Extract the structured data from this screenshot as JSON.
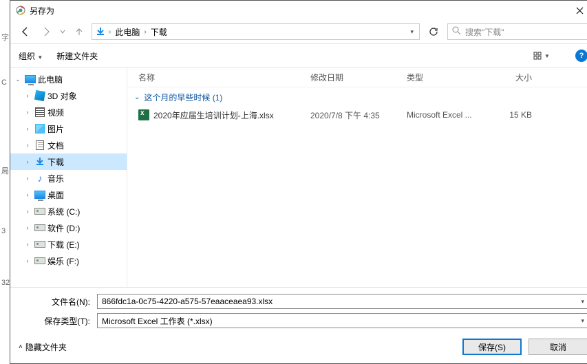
{
  "title": "另存为",
  "nav": {
    "path_segments": [
      "此电脑",
      "下载"
    ],
    "search_placeholder": "搜索\"下载\""
  },
  "toolbar": {
    "organize": "组织",
    "new_folder": "新建文件夹"
  },
  "tree": {
    "root": "此电脑",
    "items": [
      {
        "label": "3D 对象",
        "icon": "cube"
      },
      {
        "label": "视频",
        "icon": "film"
      },
      {
        "label": "图片",
        "icon": "pic"
      },
      {
        "label": "文档",
        "icon": "doc"
      },
      {
        "label": "下载",
        "icon": "dl",
        "selected": true
      },
      {
        "label": "音乐",
        "icon": "music"
      },
      {
        "label": "桌面",
        "icon": "monitor"
      },
      {
        "label": "系统 (C:)",
        "icon": "drive"
      },
      {
        "label": "软件 (D:)",
        "icon": "drive"
      },
      {
        "label": "下载 (E:)",
        "icon": "drive"
      },
      {
        "label": "娱乐 (F:)",
        "icon": "drive"
      }
    ]
  },
  "columns": {
    "name": "名称",
    "modified": "修改日期",
    "type": "类型",
    "size": "大小"
  },
  "group_header": "这个月的早些时候 (1)",
  "files": [
    {
      "name": "2020年应届生培训计划-上海.xlsx",
      "modified": "2020/7/8 下午 4:35",
      "type": "Microsoft Excel ...",
      "size": "15 KB"
    }
  ],
  "form": {
    "filename_label": "文件名(N):",
    "filename_value": "866fdc1a-0c75-4220-a575-57eaaceaea93.xlsx",
    "savetype_label": "保存类型(T):",
    "savetype_value": "Microsoft Excel 工作表 (*.xlsx)"
  },
  "footer": {
    "hide_folders": "隐藏文件夹",
    "save": "保存(S)",
    "cancel": "取消"
  }
}
